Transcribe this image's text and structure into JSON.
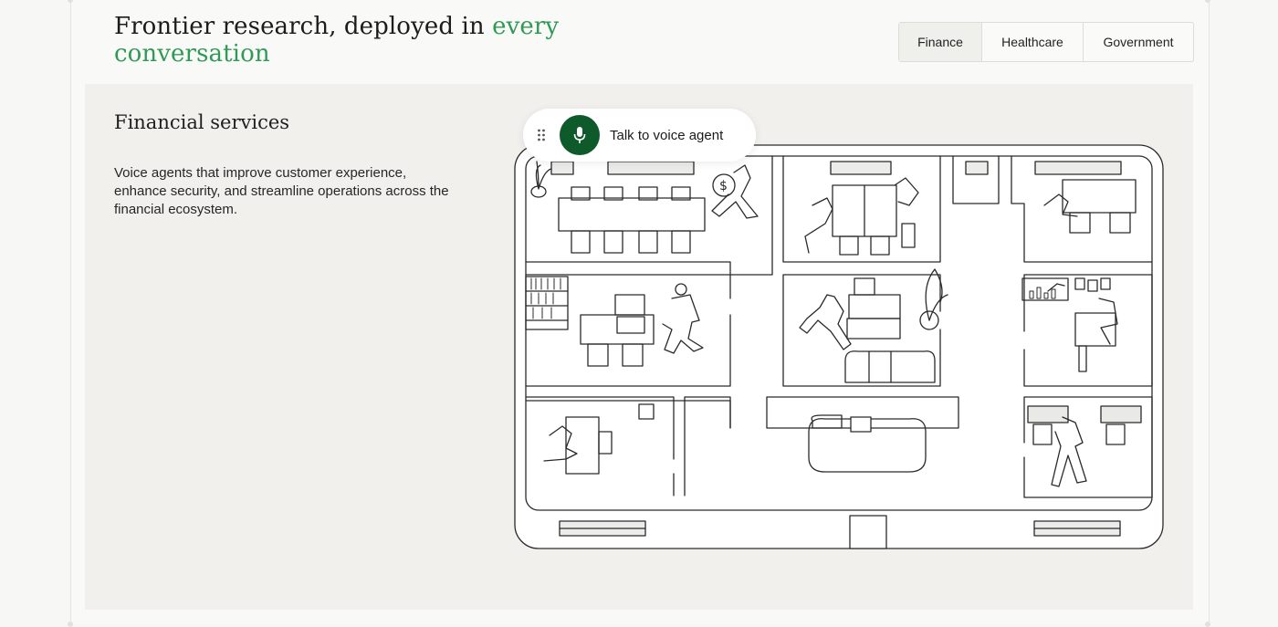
{
  "header": {
    "headline_main": "Frontier research, deployed in",
    "headline_accent": "every conversation",
    "accent_color": "#2f9a55"
  },
  "tabs": [
    {
      "label": "Finance",
      "active": true
    },
    {
      "label": "Healthcare",
      "active": false
    },
    {
      "label": "Government",
      "active": false
    }
  ],
  "panel": {
    "title": "Financial services",
    "description": "Voice agents that improve customer experience, enhance security, and streamline operations across the financial ecosystem."
  },
  "voice_agent": {
    "label": "Talk to voice agent",
    "button_color": "#0f5a2b",
    "icon": "microphone-icon"
  },
  "illustration": {
    "subject": "office-floorplan"
  }
}
